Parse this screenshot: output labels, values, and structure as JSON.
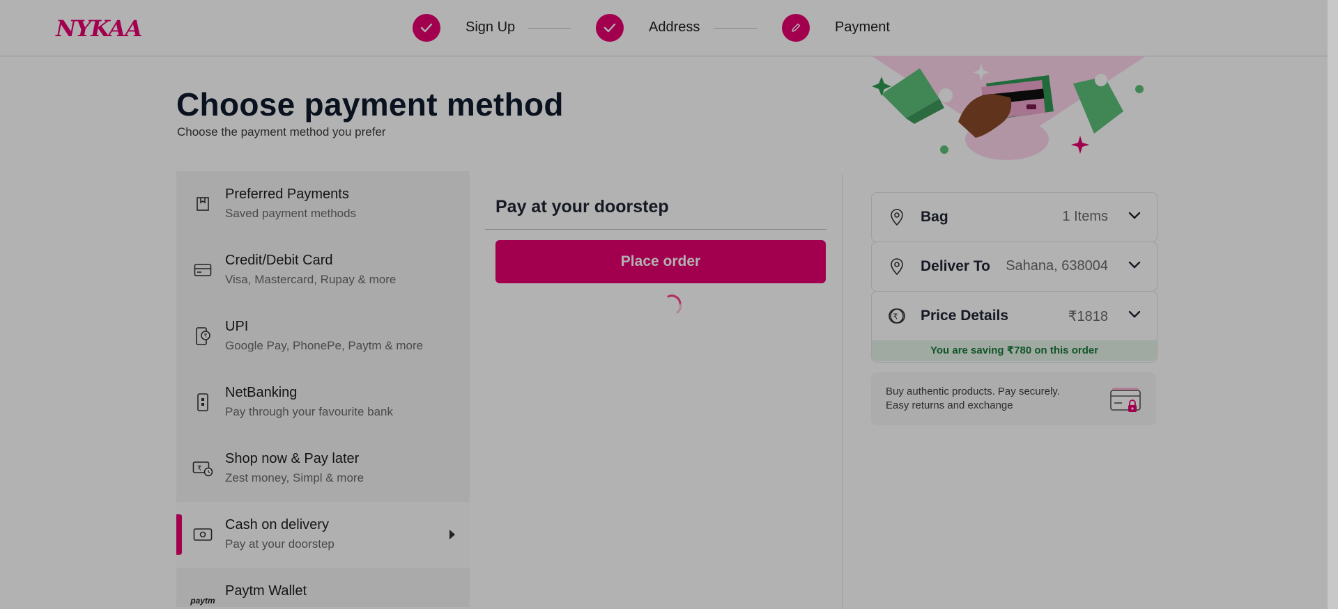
{
  "header": {
    "logo": "NYKAA",
    "steps": [
      {
        "label": "Sign Up",
        "state": "done"
      },
      {
        "label": "Address",
        "state": "done"
      },
      {
        "label": "Payment",
        "state": "current"
      }
    ]
  },
  "page": {
    "title": "Choose payment method",
    "subtitle": "Choose the payment method you prefer"
  },
  "methods": [
    {
      "title": "Preferred Payments",
      "subtitle": "Saved payment methods",
      "icon": "bookmark-icon"
    },
    {
      "title": "Credit/Debit Card",
      "subtitle": "Visa, Mastercard, Rupay & more",
      "icon": "card-icon"
    },
    {
      "title": "UPI",
      "subtitle": "Google Pay, PhonePe, Paytm & more",
      "icon": "upi-icon"
    },
    {
      "title": "NetBanking",
      "subtitle": "Pay through your favourite bank",
      "icon": "bank-icon"
    },
    {
      "title": "Shop now & Pay later",
      "subtitle": "Zest money, Simpl & more",
      "icon": "pay-later-icon"
    },
    {
      "title": "Cash on delivery",
      "subtitle": "Pay at your doorstep",
      "icon": "cash-icon",
      "active": true
    },
    {
      "title": "Paytm Wallet",
      "subtitle": "",
      "icon": "paytm-icon",
      "icon_text": "paytm"
    }
  ],
  "center": {
    "title": "Pay at your doorstep",
    "button": "Place order"
  },
  "summary": {
    "bag": {
      "label": "Bag",
      "value": "1 Items"
    },
    "deliver": {
      "label": "Deliver To",
      "value": "Sahana, 638004"
    },
    "price": {
      "label": "Price Details",
      "value": "₹1818"
    },
    "saving": "You are saving ₹780 on this order"
  },
  "trust": {
    "line1": "Buy authentic products. Pay securely.",
    "line2": "Easy returns and exchange"
  },
  "colors": {
    "brand": "#e80071",
    "saving_bg": "#e6f4ea",
    "saving_text": "#1a7a3a"
  }
}
